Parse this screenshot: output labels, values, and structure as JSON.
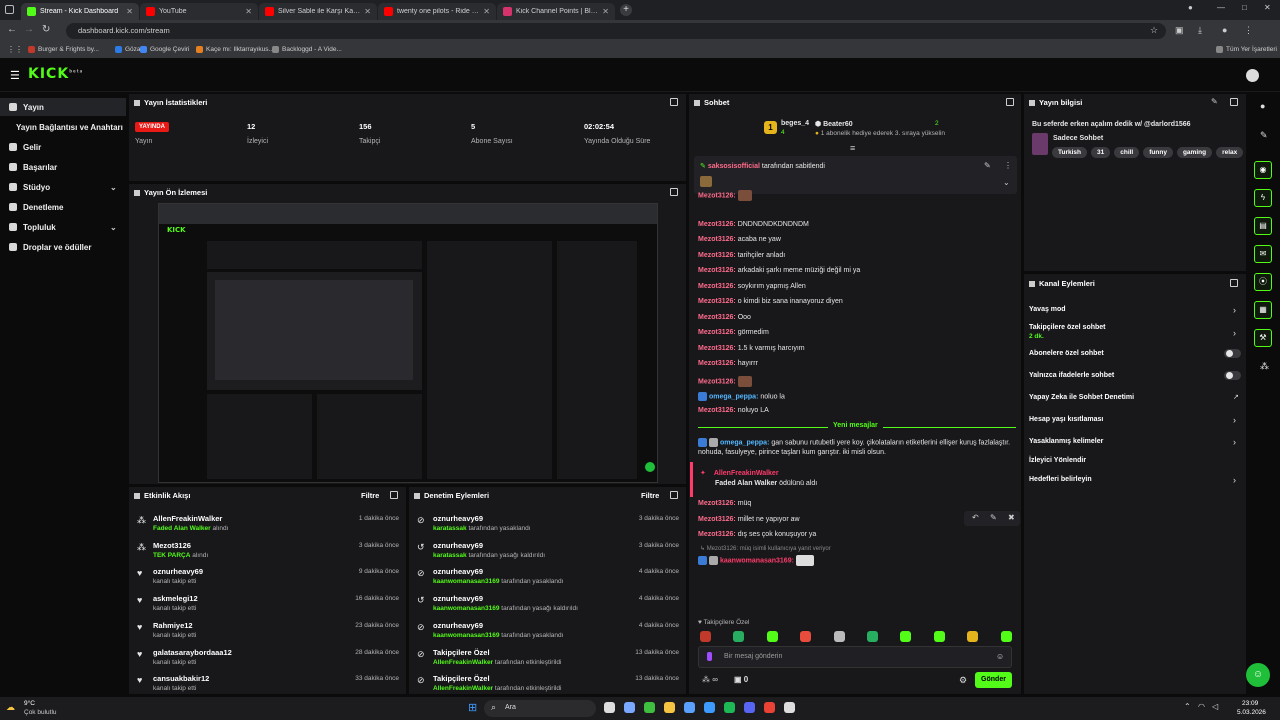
{
  "browser": {
    "tabs": [
      {
        "title": "Stream - Kick Dashboard",
        "color": "#53fc18",
        "active": true
      },
      {
        "title": "YouTube",
        "color": "#ff0000"
      },
      {
        "title": "Silver Sable ile Karşı Karşıya Ge...",
        "color": "#ff0000"
      },
      {
        "title": "twenty one pilots - Ride (Officia...",
        "color": "#ff0000"
      },
      {
        "title": "Kick Channel Points | Blerp",
        "color": "#d6336c"
      }
    ],
    "url": "dashboard.kick.com/stream",
    "bookmarks": [
      "Burger & Frights by...",
      "Gözat",
      "Google Çeviri",
      "Kaçe mı: Ilktarrayıkus...",
      "Backloggd - A Vide..."
    ],
    "all_bookmarks": "Tüm Yer İşaretleri"
  },
  "logo": "KICK",
  "logo_sup": "beta",
  "sidebar": {
    "items": [
      {
        "label": "Yayın",
        "active": true
      },
      {
        "label": "Yayın Bağlantısı ve Anahtarı"
      },
      {
        "label": "Gelir"
      },
      {
        "label": "Başarılar"
      },
      {
        "label": "Stüdyo",
        "chev": true
      },
      {
        "label": "Denetleme"
      },
      {
        "label": "Topluluk",
        "chev": true
      },
      {
        "label": "Droplar ve ödüller"
      }
    ]
  },
  "stats": {
    "title": "Yayın İstatistikleri",
    "live": "YAYINDA",
    "items": [
      {
        "value": "",
        "label": "Yayın"
      },
      {
        "value": "12",
        "label": "İzleyici"
      },
      {
        "value": "156",
        "label": "Takipçi"
      },
      {
        "value": "5",
        "label": "Abone Sayısı"
      },
      {
        "value": "02:02:54",
        "label": "Yayında Olduğu Süre"
      }
    ]
  },
  "preview": {
    "title": "Yayın Ön İzlemesi"
  },
  "activity": {
    "title": "Etkinlik Akışı",
    "filter": "Filtre",
    "rows": [
      {
        "name": "AllenFreakinWalker",
        "hl": "Faded Alan Walker",
        "sub": "alındı",
        "time": "1 dakika önce"
      },
      {
        "name": "Mezot3126",
        "hl": "TEK PARÇA",
        "sub": "alındı",
        "time": "3 dakika önce"
      },
      {
        "name": "oznurheavy69",
        "hl": "",
        "sub": "kanalı takip etti",
        "time": "9 dakika önce"
      },
      {
        "name": "askmelegi12",
        "hl": "",
        "sub": "kanalı takip etti",
        "time": "16 dakika önce"
      },
      {
        "name": "Rahmiye12",
        "hl": "",
        "sub": "kanalı takip etti",
        "time": "23 dakika önce"
      },
      {
        "name": "galatasaraybordaaa12",
        "hl": "",
        "sub": "kanalı takip etti",
        "time": "28 dakika önce"
      },
      {
        "name": "cansuakbakir12",
        "hl": "",
        "sub": "kanalı takip etti",
        "time": "33 dakika önce"
      }
    ]
  },
  "moderation": {
    "title": "Denetim Eylemleri",
    "filter": "Filtre",
    "rows": [
      {
        "name": "oznurheavy69",
        "hl": "karatassak",
        "sub": "tarafından yasaklandı",
        "time": "3 dakika önce"
      },
      {
        "name": "oznurheavy69",
        "hl": "karatassak",
        "sub": "tarafından yasağı kaldırıldı",
        "time": "3 dakika önce"
      },
      {
        "name": "oznurheavy69",
        "hl": "kaanwomanasan3169",
        "sub": "tarafından yasaklandı",
        "time": "4 dakika önce"
      },
      {
        "name": "oznurheavy69",
        "hl": "kaanwomanasan3169",
        "sub": "tarafından yasağı kaldırıldı",
        "time": "4 dakika önce"
      },
      {
        "name": "oznurheavy69",
        "hl": "kaanwomanasan3169",
        "sub": "tarafından yasaklandı",
        "time": "4 dakika önce"
      },
      {
        "name": "Takipçilere Özel",
        "hl": "AllenFreakinWalker",
        "sub": "tarafından etkinleştirildi",
        "time": "13 dakika önce"
      },
      {
        "name": "Takipçilere Özel",
        "hl": "AllenFreakinWalker",
        "sub": "tarafından etkinleştirildi",
        "time": "13 dakika önce"
      }
    ]
  },
  "chat": {
    "title": "Sohbet",
    "top1": {
      "name": "beges_4",
      "count": "4"
    },
    "top2": {
      "name": "Beater60",
      "count": "2",
      "note": "1 abonelik hediye ederek 3. sıraya yükselin"
    },
    "pinned_by": "saksosisofficial",
    "pinned_text": "tarafından sabitlendi",
    "messages": [
      {
        "u": "Mezot3126:",
        "t": "",
        "img": true
      },
      {
        "u": "Mezot3126:",
        "t": "DNDNDNDKDNDNDM"
      },
      {
        "u": "Mezot3126:",
        "t": "acaba ne yaw"
      },
      {
        "u": "Mezot3126:",
        "t": "tarihçiler anladı"
      },
      {
        "u": "Mezot3126:",
        "t": "arkadaki şarkı meme müziği değil mi ya"
      },
      {
        "u": "Mezot3126:",
        "t": "soykırım yapmış Allen"
      },
      {
        "u": "Mezot3126:",
        "t": "o kimdi biz sana inanayoruz diyen"
      },
      {
        "u": "Mezot3126:",
        "t": "Ooo"
      },
      {
        "u": "Mezot3126:",
        "t": "görmedim"
      },
      {
        "u": "Mezot3126:",
        "t": "1.5 k varmış harcıyım"
      },
      {
        "u": "Mezot3126:",
        "t": "hayırrr"
      },
      {
        "u": "Mezot3126:",
        "t": "",
        "img": true
      },
      {
        "u": "omega_peppa:",
        "t": "noluo la",
        "blue": true
      },
      {
        "u": "Mezot3126:",
        "t": "noluyo LA"
      }
    ],
    "new_messages": "Yeni mesajlar",
    "long_msg_user": "omega_peppa:",
    "long_msg_l1": "gan sabunu rutubetli yere koy. çikolataların etiketlerini ellişer kuruş fazlalaştır.",
    "long_msg_l2": "nohuda, fasulyeye, pirince taşları kum garıştır. iki misli olsun.",
    "redeem_user": "AllenFreakinWalker",
    "redeem_item": "Faded Alan Walker",
    "redeem_text": "ödülünü aldı",
    "after": [
      {
        "u": "Mezot3126:",
        "t": "müq"
      },
      {
        "u": "Mezot3126:",
        "t": "millet ne yapıyor aw"
      },
      {
        "u": "Mezot3126:",
        "t": "dış ses çok konuşuyor ya"
      }
    ],
    "reply_note": "Mezot3126: müq isimli kullanıcıya yanıt veriyor",
    "reply_user": "kaanwomanasan3169:",
    "followers_only": "Takipçilere Özel",
    "input_placeholder": "Bir mesaj gönderin",
    "send": "Gönder",
    "points": "0",
    "infinity": "∞"
  },
  "info": {
    "title": "Yayın bilgisi",
    "stream_title": "Bu seferde erken açalım dedik w/ @darlord1566",
    "category": "Sadece Sohbet",
    "tags": [
      "Turkish",
      "31",
      "chill",
      "funny",
      "gaming",
      "relax"
    ]
  },
  "actions": {
    "title": "Kanal Eylemleri",
    "items": [
      {
        "label": "Yavaş mod",
        "type": "chev"
      },
      {
        "label": "Takipçilere özel sohbet",
        "sub": "2 dk.",
        "type": "chev"
      },
      {
        "label": "Abonelere özel sohbet",
        "type": "toggle"
      },
      {
        "label": "Yalnızca ifadelerle sohbet",
        "type": "toggle"
      },
      {
        "label": "Yapay Zeka ile Sohbet Denetimi",
        "type": "ext"
      },
      {
        "label": "Hesap yaşı kısıtlaması",
        "type": "chev"
      },
      {
        "label": "Yasaklanmış kelimeler",
        "type": "chev"
      },
      {
        "label": "İzleyici Yönlendir",
        "type": "none"
      },
      {
        "label": "Hedefleri belirleyin",
        "type": "chev"
      }
    ]
  },
  "taskbar": {
    "weather_temp": "9°C",
    "weather": "Çok bulutlu",
    "search": "Ara",
    "time": "23:09",
    "date": "5.03.2026"
  },
  "colors": {
    "accent": "#53fc18",
    "live": "#e91916",
    "panel": "#18181b"
  }
}
